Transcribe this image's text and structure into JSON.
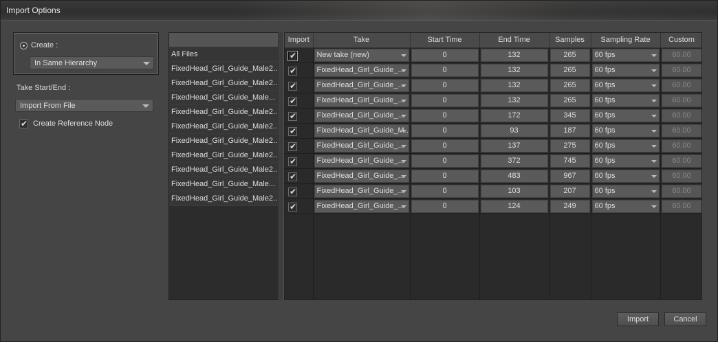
{
  "window": {
    "title": "Import Options"
  },
  "options": {
    "create_label": "Create :",
    "hierarchy_value": "In Same Hierarchy",
    "take_label": "Take Start/End :",
    "take_value": "Import From File",
    "reference_label": "Create Reference Node",
    "reference_checked": true
  },
  "files": {
    "all_label": "All Files",
    "items": [
      "FixedHead_Girl_Guide_Male2...",
      "FixedHead_Girl_Guide_Male2...",
      "FixedHead_Girl_Guide_Male...",
      "FixedHead_Girl_Guide_Male2...",
      "FixedHead_Girl_Guide_Male2...",
      "FixedHead_Girl_Guide_Male2...",
      "FixedHead_Girl_Guide_Male2...",
      "FixedHead_Girl_Guide_Male2...",
      "FixedHead_Girl_Guide_Male...",
      "FixedHead_Girl_Guide_Male2..."
    ]
  },
  "grid": {
    "columns": [
      "Import",
      "Take",
      "Start Time",
      "End Time",
      "Samples",
      "Sampling Rate",
      "Custom"
    ],
    "rows": [
      {
        "take": "New take (new)",
        "start": "0",
        "end": "132",
        "samples": "265",
        "rate": "60 fps",
        "custom": "60.00"
      },
      {
        "take": "FixedHead_Girl_Guide_...",
        "start": "0",
        "end": "132",
        "samples": "265",
        "rate": "60 fps",
        "custom": "60.00"
      },
      {
        "take": "FixedHead_Girl_Guide_...",
        "start": "0",
        "end": "132",
        "samples": "265",
        "rate": "60 fps",
        "custom": "60.00"
      },
      {
        "take": "FixedHead_Girl_Guide_...",
        "start": "0",
        "end": "132",
        "samples": "265",
        "rate": "60 fps",
        "custom": "60.00"
      },
      {
        "take": "FixedHead_Girl_Guide_...",
        "start": "0",
        "end": "172",
        "samples": "345",
        "rate": "60 fps",
        "custom": "60.00"
      },
      {
        "take": "FixedHead_Girl_Guide_M...",
        "start": "0",
        "end": "93",
        "samples": "187",
        "rate": "60 fps",
        "custom": "60.00"
      },
      {
        "take": "FixedHead_Girl_Guide_...",
        "start": "0",
        "end": "137",
        "samples": "275",
        "rate": "60 fps",
        "custom": "60.00"
      },
      {
        "take": "FixedHead_Girl_Guide_...",
        "start": "0",
        "end": "372",
        "samples": "745",
        "rate": "60 fps",
        "custom": "60.00"
      },
      {
        "take": "FixedHead_Girl_Guide_...",
        "start": "0",
        "end": "483",
        "samples": "967",
        "rate": "60 fps",
        "custom": "60.00"
      },
      {
        "take": "FixedHead_Girl_Guide_...",
        "start": "0",
        "end": "103",
        "samples": "207",
        "rate": "60 fps",
        "custom": "60.00"
      },
      {
        "take": "FixedHead_Girl_Guide_...",
        "start": "0",
        "end": "124",
        "samples": "249",
        "rate": "60 fps",
        "custom": "60.00"
      }
    ]
  },
  "buttons": {
    "import": "Import",
    "cancel": "Cancel"
  },
  "icons": {
    "check": "checkmark-icon",
    "dropdown": "chevron-down-icon",
    "radio": "radio-selected-icon"
  }
}
